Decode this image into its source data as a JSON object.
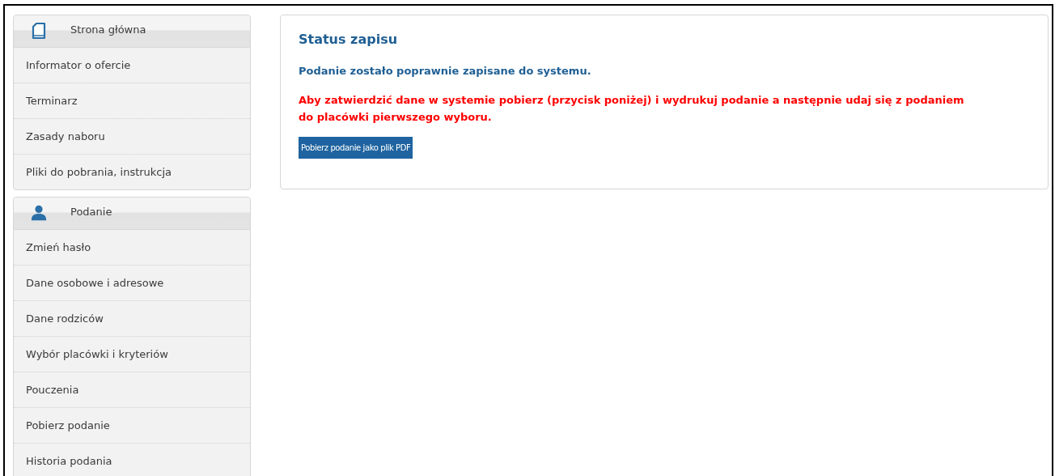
{
  "sidebar": {
    "sections": [
      {
        "kind": "document",
        "title": "Strona główna",
        "items": [
          "Informator o ofercie",
          "Terminarz",
          "Zasady naboru",
          "Pliki do pobrania, instrukcja"
        ]
      },
      {
        "kind": "user",
        "title": "Podanie",
        "items": [
          "Zmień hasło",
          "Dane osobowe i adresowe",
          "Dane rodziców",
          "Wybór placówki i kryteriów",
          "Pouczenia",
          "Pobierz podanie",
          "Historia podania"
        ]
      }
    ]
  },
  "status": {
    "title": "Status zapisu",
    "success_message": "Podanie zostało poprawnie zapisane do systemu.",
    "warning_message": "Aby zatwierdzić dane w systemie pobierz (przycisk poniżej) i wydrukuj podanie a następnie udaj się z podaniem do placówki pierwszego wyboru.",
    "button": "Pobierz podanie jako plik PDF"
  }
}
